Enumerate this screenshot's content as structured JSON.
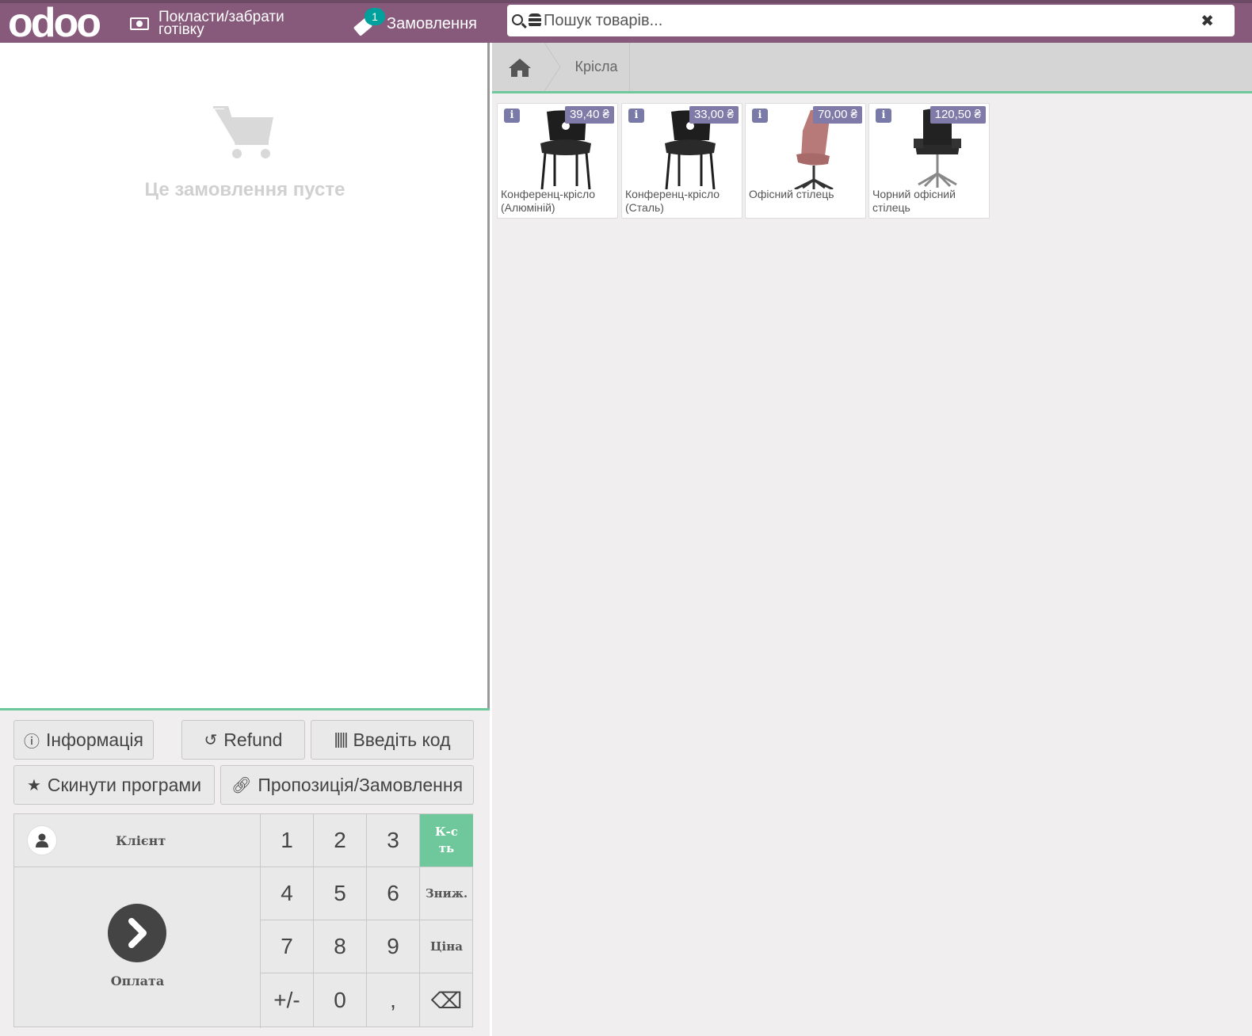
{
  "header": {
    "logo_text": "odoo",
    "cash_button_label": "Покласти/забрати готівку",
    "orders_badge": "1",
    "orders_label": "Замовлення",
    "search_placeholder": "Пошук товарів...",
    "clear_symbol": "✖"
  },
  "order": {
    "empty_text": "Це замовлення пусте"
  },
  "controls": {
    "info_label": "Інформація",
    "refund_label": "Refund",
    "code_label": "Введіть код",
    "reset_label": "Скинути програми",
    "quote_label": "Пропозиція/Замовлення"
  },
  "numpad": {
    "customer_label": "Клієнт",
    "payment_label": "Оплата",
    "keys": [
      "1",
      "2",
      "3",
      "4",
      "5",
      "6",
      "7",
      "8",
      "9",
      "+/-",
      "0",
      ","
    ],
    "mode_qty": "К-сть",
    "mode_disc": "Зниж.",
    "mode_price": "Ціна",
    "backspace": "⌫"
  },
  "breadcrumb": {
    "category": "Крісла"
  },
  "products": [
    {
      "name": "Конференц-крісло (Алюміній)",
      "price": "39,40 ₴",
      "color": "#1e1e1e"
    },
    {
      "name": "Конференц-крісло (Сталь)",
      "price": "33,00 ₴",
      "color": "#1e1e1e"
    },
    {
      "name": "Офісний стілець",
      "price": "70,00 ₴",
      "color": "#b87a78"
    },
    {
      "name": "Чорний офісний стілець",
      "price": "120,50 ₴",
      "color": "#222222"
    }
  ],
  "colors": {
    "brand": "#875a7b",
    "accent": "#6ec89b",
    "badge": "#00a09d",
    "price_tag": "#7f7aa8"
  }
}
